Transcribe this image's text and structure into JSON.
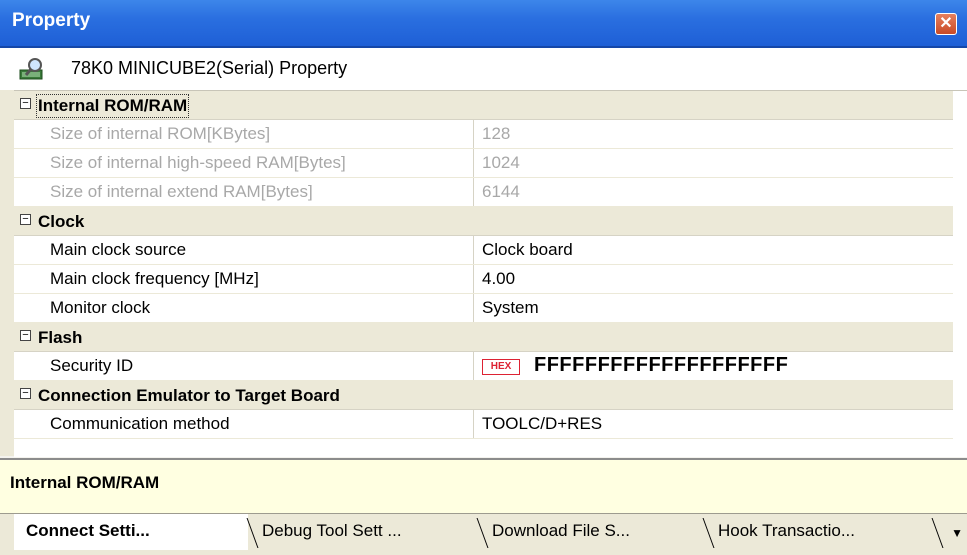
{
  "window": {
    "title": "Property",
    "close_glyph": "✕"
  },
  "header": {
    "icon": "magnifier-chip-icon",
    "label": "78K0 MINICUBE2(Serial) Property"
  },
  "categories": [
    {
      "label": "Internal ROM/RAM",
      "toggle": "−",
      "rows": [
        {
          "name": "Size of internal ROM[KBytes]",
          "value": "128",
          "disabled": true
        },
        {
          "name": "Size of internal high-speed RAM[Bytes]",
          "value": "1024",
          "disabled": true
        },
        {
          "name": "Size of internal extend RAM[Bytes]",
          "value": "6144",
          "disabled": true
        }
      ]
    },
    {
      "label": "Clock",
      "toggle": "−",
      "rows": [
        {
          "name": "Main clock source",
          "value": "Clock board"
        },
        {
          "name": "Main clock frequency [MHz]",
          "value": "4.00"
        },
        {
          "name": "Monitor clock",
          "value": "System"
        }
      ]
    },
    {
      "label": "Flash",
      "toggle": "−",
      "rows": [
        {
          "name": "Security ID",
          "badge": "HEX",
          "value": "FFFFFFFFFFFFFFFFFFFF"
        }
      ]
    },
    {
      "label": "Connection Emulator to Target Board",
      "toggle": "−",
      "rows": [
        {
          "name": "Communication method",
          "value": "TOOLC/D+RES"
        }
      ]
    }
  ],
  "description": {
    "text": "Internal ROM/RAM"
  },
  "tabs": [
    {
      "label": "Connect Setti...",
      "active": true
    },
    {
      "label": "Debug Tool Sett ...",
      "active": false
    },
    {
      "label": "Download File S...",
      "active": false
    },
    {
      "label": "Hook Transactio...",
      "active": false
    }
  ],
  "tab_menu_glyph": "▼",
  "colors": {
    "titlebar": "#2a6fe0",
    "description_bg": "#ffffe1",
    "category_bg": "#ece9d8",
    "hex_badge": "#dd2233"
  }
}
